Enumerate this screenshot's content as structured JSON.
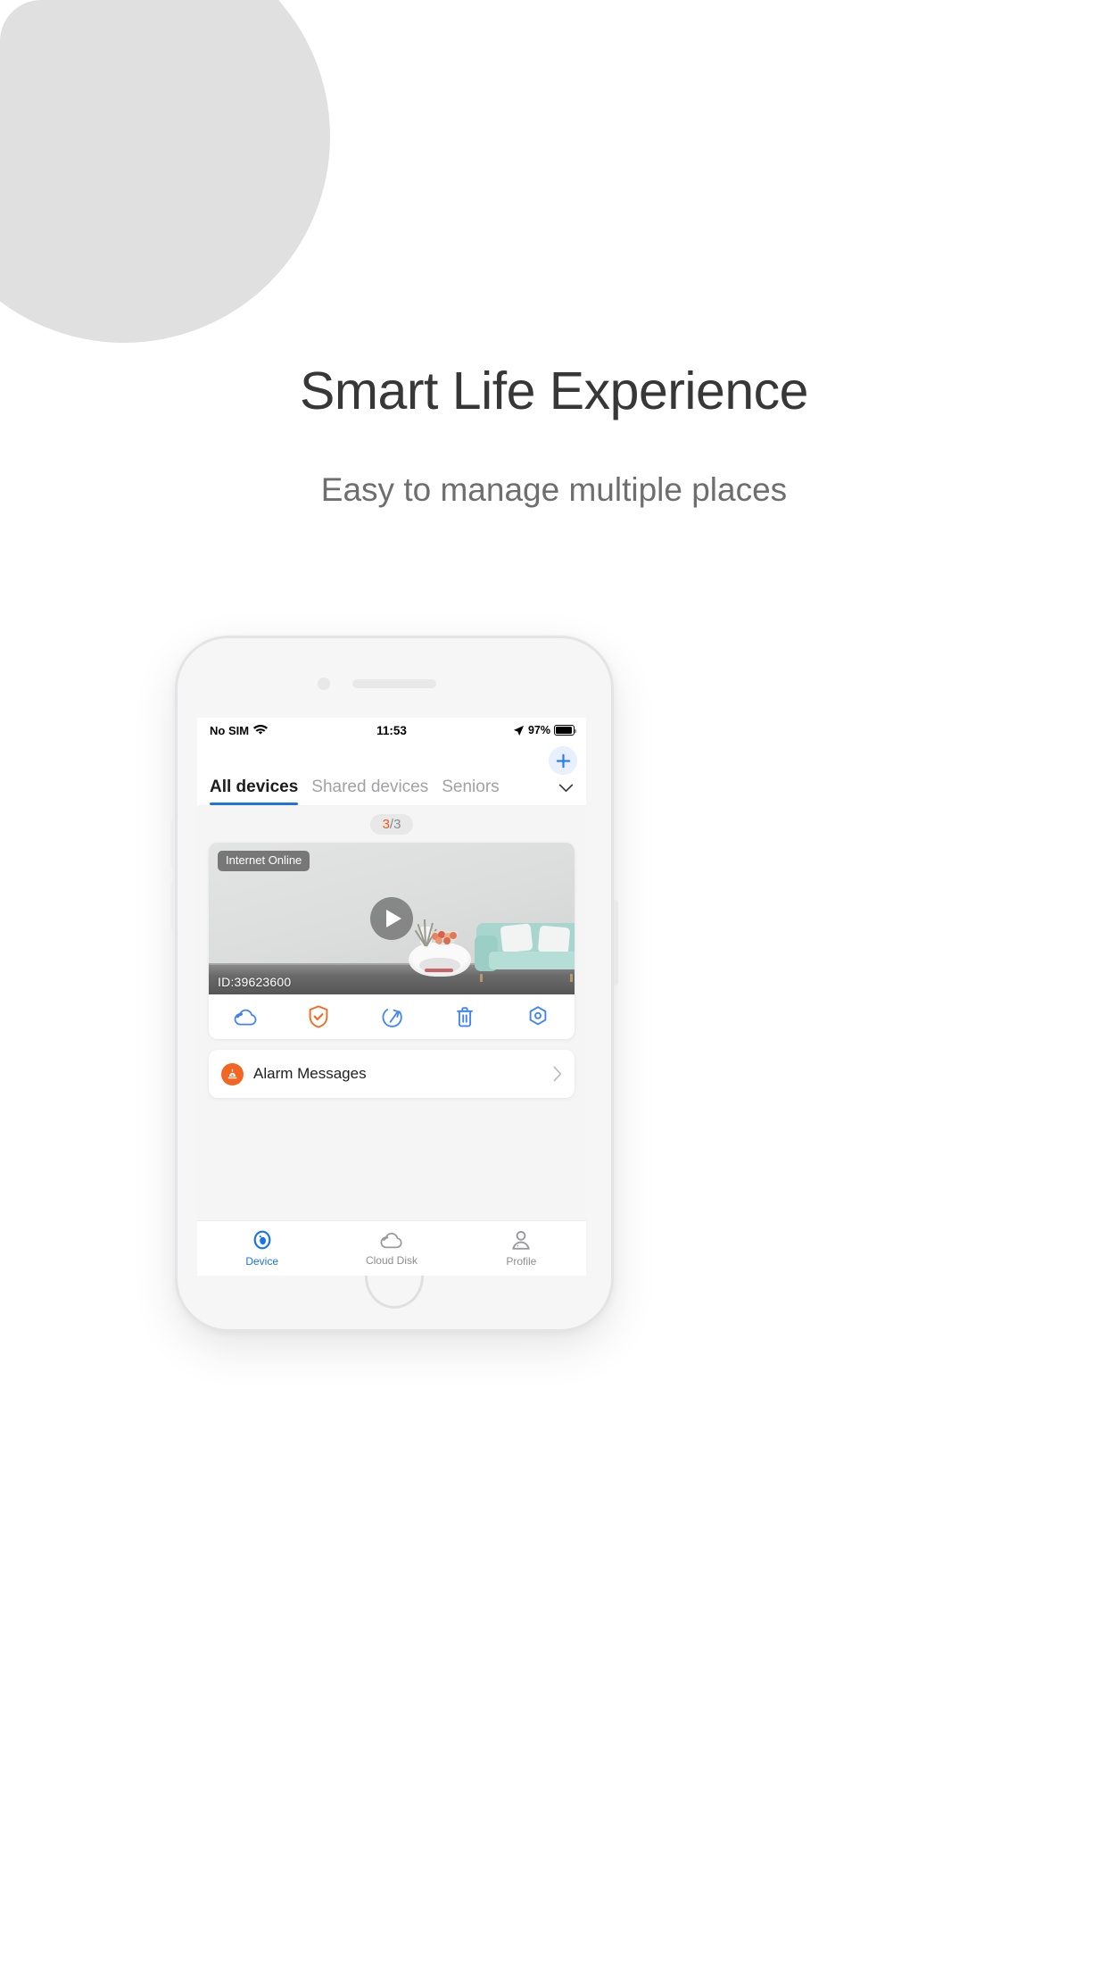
{
  "promo": {
    "headline": "Smart Life Experience",
    "subheadline": "Easy to manage multiple places"
  },
  "colors": {
    "accent_blue": "#1a73e8",
    "accent_orange": "#f0571f",
    "alarm_orange": "#f26522",
    "sofa_teal": "#a8d6ce",
    "deco_gray": "#e0e0e0",
    "badge_gray": "#5f5f5f"
  },
  "phone": {
    "statusbar": {
      "carrier": "No SIM",
      "wifi_icon": "wifi-icon",
      "time": "11:53",
      "location_icon": "location-arrow-icon",
      "battery_percent": "97%",
      "battery_icon": "battery-full-icon"
    },
    "header": {
      "add_button_icon": "plus-icon",
      "more_tabs_icon": "chevron-down-icon",
      "tabs": [
        {
          "label": "All devices",
          "active": true
        },
        {
          "label": "Shared devices",
          "active": false
        },
        {
          "label": "Seniors",
          "active": false
        }
      ]
    },
    "content": {
      "counter": {
        "current": "3",
        "separator": "/",
        "total": "3"
      },
      "device_card": {
        "status_badge": "Internet Online",
        "device_id": "ID:39623600",
        "play_icon": "play-icon",
        "actions": [
          {
            "name": "cloud-storage-icon",
            "icon": "cloud-icon",
            "color": "#4285f4"
          },
          {
            "name": "security-shield-icon",
            "icon": "shield-check-icon",
            "color": "#f0571f"
          },
          {
            "name": "share-icon",
            "icon": "share-arrow-icon",
            "color": "#4285f4"
          },
          {
            "name": "delete-icon",
            "icon": "trash-icon",
            "color": "#4285f4"
          },
          {
            "name": "settings-icon",
            "icon": "hexagon-gear-icon",
            "color": "#4285f4"
          }
        ]
      },
      "alarm_row": {
        "icon": "alarm-bell-icon",
        "label": "Alarm Messages",
        "chevron": "chevron-right-icon"
      }
    },
    "bottom_nav": [
      {
        "label": "Device",
        "icon": "camera-lens-icon",
        "active": true
      },
      {
        "label": "Cloud Disk",
        "icon": "cloud-icon",
        "active": false
      },
      {
        "label": "Profile",
        "icon": "person-icon",
        "active": false
      }
    ]
  }
}
